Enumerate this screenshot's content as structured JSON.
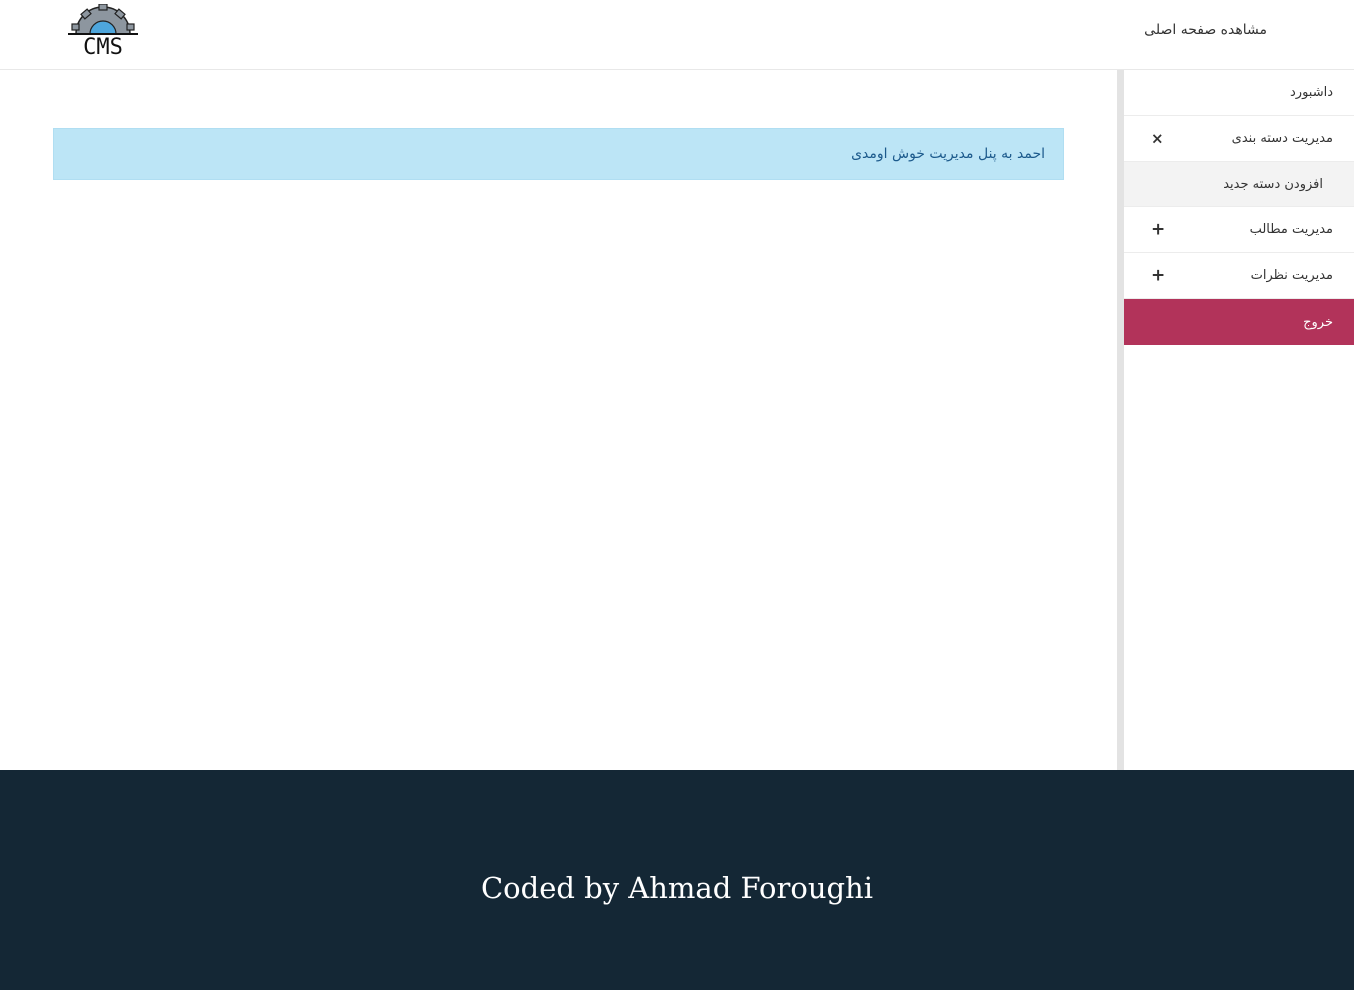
{
  "header": {
    "logo_text": "CMS",
    "home_link": "مشاهده صفحه اصلی"
  },
  "sidebar": {
    "items": [
      {
        "label": "داشبورد"
      },
      {
        "label": "مدیریت دسته بندی",
        "toggle": "×",
        "expanded": true,
        "children": [
          {
            "label": "افزودن دسته جدید"
          }
        ]
      },
      {
        "label": "مدیریت مطالب",
        "toggle": "+"
      },
      {
        "label": "مدیریت نظرات",
        "toggle": "+"
      }
    ],
    "logout": "خروج"
  },
  "main": {
    "welcome": "احمد به پنل مدیریت خوش اومدی"
  },
  "footer": {
    "credit": "Coded by Ahmad Foroughi"
  },
  "colors": {
    "accent": "#b2335a",
    "footer_bg": "#142735",
    "alert_bg": "#bce5f6",
    "alert_text": "#1c5a8c"
  }
}
